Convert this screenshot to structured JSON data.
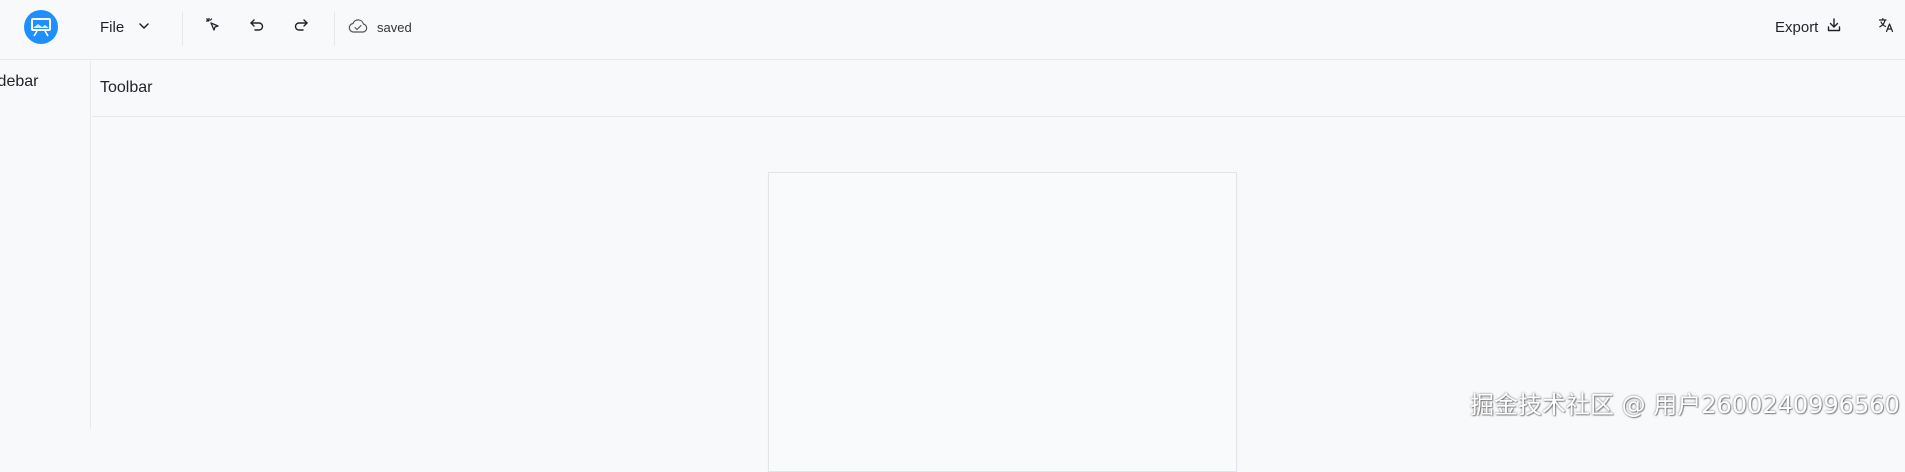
{
  "header": {
    "file_menu_label": "File",
    "status_text": "saved",
    "export_label": "Export",
    "icons": {
      "logo": "presentation-logo-icon",
      "file_chevron": "chevron-down-icon",
      "pointer": "sparkle-pointer-icon",
      "undo": "undo-icon",
      "redo": "redo-icon",
      "status": "cloud-check-icon",
      "export": "download-icon",
      "language": "translate-icon"
    }
  },
  "sidebar": {
    "label": "idebar"
  },
  "toolbar": {
    "label": "Toolbar"
  },
  "watermark": {
    "text": "掘金技术社区 @ 用户2600240996560"
  },
  "colors": {
    "accent": "#1f8fff",
    "background": "#f8f9fb",
    "border": "#e6e8ec"
  }
}
